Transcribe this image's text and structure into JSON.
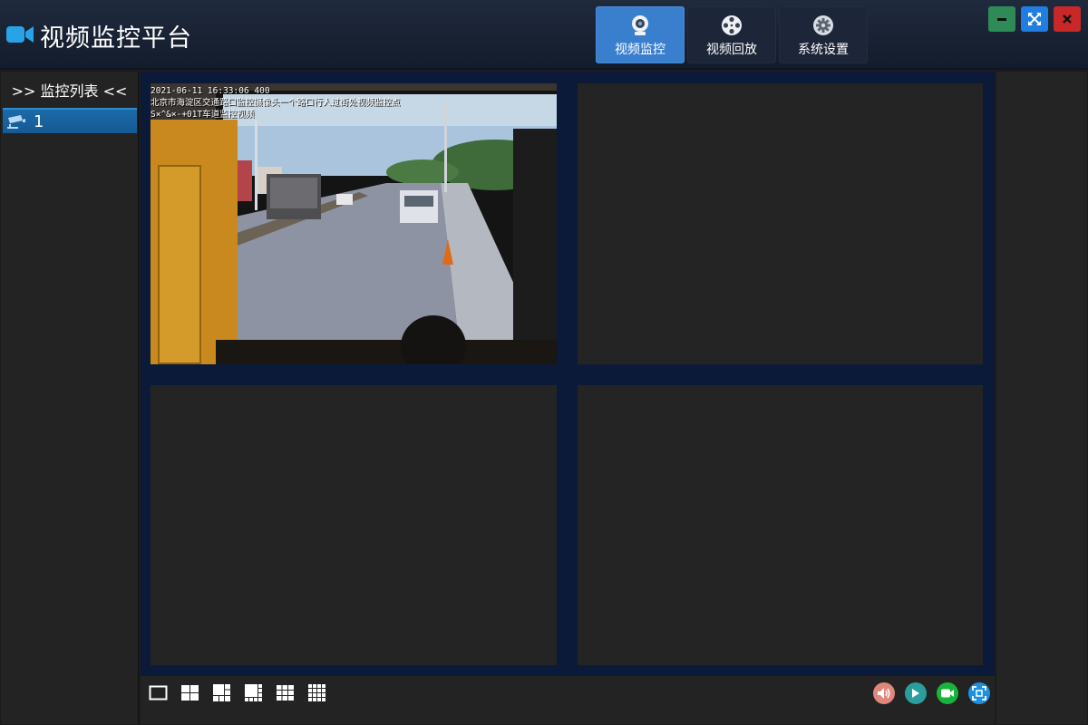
{
  "app": {
    "title": "视频监控平台",
    "logo_icon": "video-camera-icon"
  },
  "nav": {
    "items": [
      {
        "label": "视频监控",
        "icon": "webcam-icon",
        "active": true
      },
      {
        "label": "视频回放",
        "icon": "film-reel-icon",
        "active": false
      },
      {
        "label": "系统设置",
        "icon": "gear-icon",
        "active": false
      }
    ]
  },
  "window_controls": {
    "minimize_icon": "minimize-icon",
    "maximize_icon": "fullscreen-arrows-icon",
    "close_icon": "close-icon"
  },
  "sidebar": {
    "header": ">> 监控列表 <<",
    "items": [
      {
        "label": "1",
        "icon": "cctv-camera-icon"
      }
    ]
  },
  "video_grid": {
    "cells": [
      {
        "id": "1",
        "has_feed": true,
        "osd_timestamp": "2021-06-11 16:33:06 400",
        "osd_line2": "北京市海淀区交通路口监控摄像头一个路口行人过街处视频监控点",
        "osd_line3": "S×^&×-+01T车道监控视频"
      },
      {
        "id": "2",
        "has_feed": false
      },
      {
        "id": "3",
        "has_feed": false
      },
      {
        "id": "4",
        "has_feed": false
      }
    ]
  },
  "toolbar": {
    "layouts": [
      "layout-1x1-icon",
      "layout-2x2-icon",
      "layout-1plus5-icon",
      "layout-1plus7-icon",
      "layout-3x3-icon",
      "layout-4x4-icon"
    ],
    "media_controls": [
      {
        "icon": "volume-icon",
        "color": "#e0877c"
      },
      {
        "icon": "play-icon",
        "color": "#2a9d9d"
      },
      {
        "icon": "record-icon",
        "color": "#17b43a"
      },
      {
        "icon": "fullscreen-icon",
        "color": "#1e90e0"
      }
    ]
  },
  "colors": {
    "accent": "#3a7fce",
    "titlebar": "#1a2435",
    "grid_bg": "#0c1a3a",
    "cell_bg": "#242424"
  }
}
